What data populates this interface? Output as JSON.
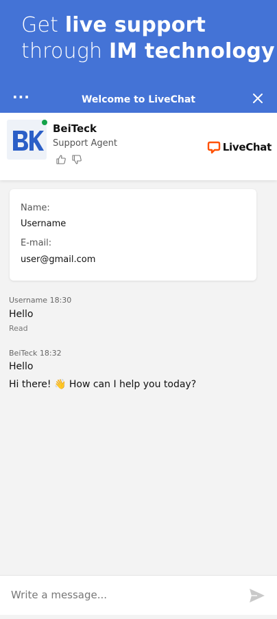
{
  "hero": {
    "line1_prefix": "Get ",
    "line1_bold": "live support",
    "line2_prefix": "through ",
    "line2_bold": "IM technology"
  },
  "titlebar": {
    "title": "Welcome to LiveChat",
    "menu_icon": "more-dots-icon",
    "close_icon": "close-icon"
  },
  "agent": {
    "name": "BeiTeck",
    "role": "Support Agent",
    "status": "online",
    "logo_text": "LiveChat"
  },
  "form": {
    "name_label": "Name:",
    "name_value": "Username",
    "email_label": "E-mail:",
    "email_value": "user@gmail.com"
  },
  "messages": [
    {
      "meta": "Username 18:30",
      "text": "Hello",
      "status": "Read"
    },
    {
      "meta": "BeiTeck 18:32",
      "text": "Hello",
      "text2": "Hi there! 👋 How can I help you today?"
    }
  ],
  "composer": {
    "placeholder": "Write a message..."
  },
  "colors": {
    "brand": "#4473d6",
    "online": "#15a34a",
    "livechat_logo": "#ff5100"
  }
}
